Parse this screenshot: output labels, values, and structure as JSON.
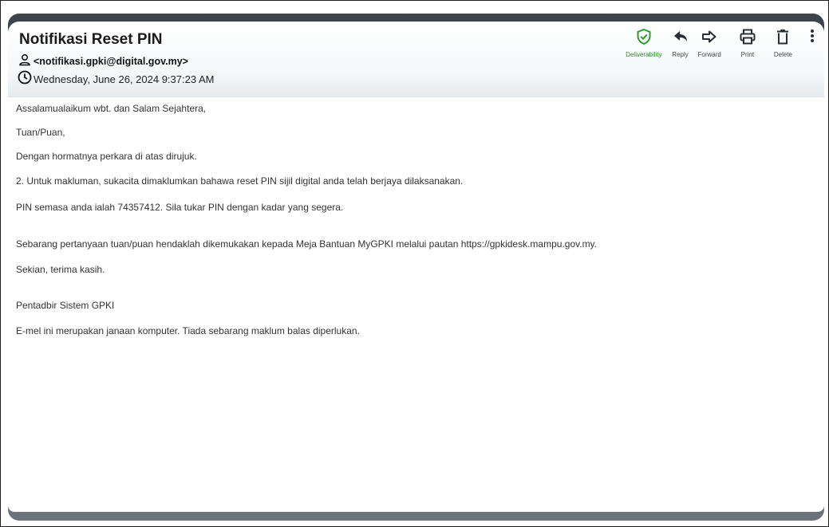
{
  "email": {
    "subject": "Notifikasi Reset PIN",
    "sender": "<notifikasi.gpki@digital.gov.my>",
    "date": "Wednesday, June 26, 2024 9:37:23 AM"
  },
  "toolbar": {
    "deliverability_label": "Deliverability",
    "reply_label": "Reply",
    "forward_label": "Forward",
    "print_label": "Print",
    "delete_label": "Delete",
    "deliverability_color": "#2e9b2e"
  },
  "body": {
    "greeting": "Assalamualaikum wbt. dan Salam Sejahtera,",
    "salutation": "Tuan/Puan,",
    "line1": "Dengan hormatnya perkara di atas dirujuk.",
    "line2": "2.   Untuk makluman, sukacita dimaklumkan bahawa reset PIN sijil digital anda telah berjaya dilaksanakan.",
    "line3": "PIN semasa anda ialah 74357412. Sila tukar PIN dengan kadar yang segera.",
    "line4": "Sebarang pertanyaan tuan/puan hendaklah dikemukakan kepada Meja Bantuan MyGPKI melalui pautan https://gpkidesk.mampu.gov.my.",
    "closing": "Sekian, terima kasih.",
    "signature": "Pentadbir Sistem GPKI",
    "disclaimer": "E-mel ini merupakan janaan komputer. Tiada sebarang maklum balas diperlukan."
  }
}
